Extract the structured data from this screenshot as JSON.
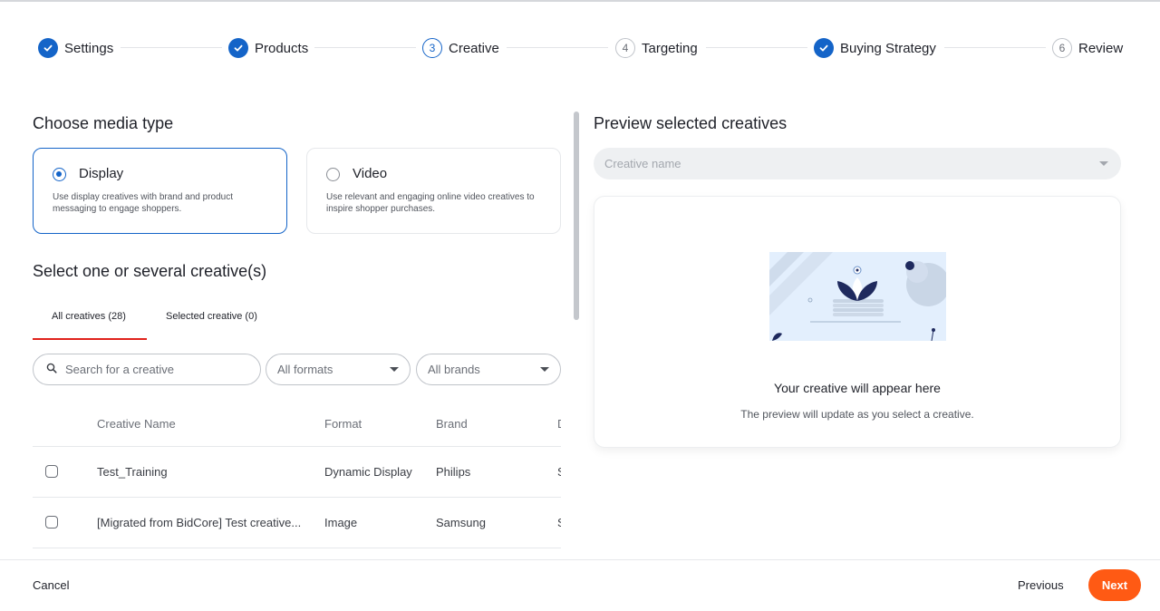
{
  "stepper": {
    "steps": [
      {
        "label": "Settings",
        "status": "done"
      },
      {
        "label": "Products",
        "status": "done"
      },
      {
        "number": "3",
        "label": "Creative",
        "status": "current"
      },
      {
        "number": "4",
        "label": "Targeting",
        "status": "todo"
      },
      {
        "label": "Buying Strategy",
        "status": "done"
      },
      {
        "number": "6",
        "label": "Review",
        "status": "todo"
      }
    ]
  },
  "media_type": {
    "heading": "Choose media type",
    "options": [
      {
        "title": "Display",
        "description": "Use display creatives with brand and product messaging to engage shoppers.",
        "selected": true
      },
      {
        "title": "Video",
        "description": "Use relevant and engaging online video creatives to inspire shopper purchases.",
        "selected": false
      }
    ]
  },
  "creatives": {
    "heading": "Select one or several creative(s)",
    "tabs": [
      {
        "label": "All creatives (28)",
        "active": true
      },
      {
        "label": "Selected creative (0)",
        "active": false
      }
    ],
    "search": {
      "placeholder": "Search for a creative",
      "icon": "search-icon"
    },
    "filters": [
      {
        "placeholder": "All formats"
      },
      {
        "placeholder": "All brands"
      }
    ],
    "columns": [
      "Creative Name",
      "Format",
      "Brand",
      "D"
    ],
    "rows": [
      {
        "name": "Test_Training",
        "format": "Dynamic Display",
        "brand": "Philips",
        "extra": "S"
      },
      {
        "name": "[Migrated from BidCore] Test creative...",
        "format": "Image",
        "brand": "Samsung",
        "extra": "S"
      }
    ]
  },
  "preview": {
    "heading": "Preview selected creatives",
    "select_placeholder": "Creative name",
    "empty_title": "Your creative will appear here",
    "empty_subtitle": "The preview will update as you select a creative."
  },
  "footer": {
    "cancel": "Cancel",
    "previous": "Previous",
    "next": "Next"
  },
  "colors": {
    "primary_blue": "#1464c8",
    "accent_orange": "#ff5a14",
    "tab_underline_red": "#e0231b"
  }
}
